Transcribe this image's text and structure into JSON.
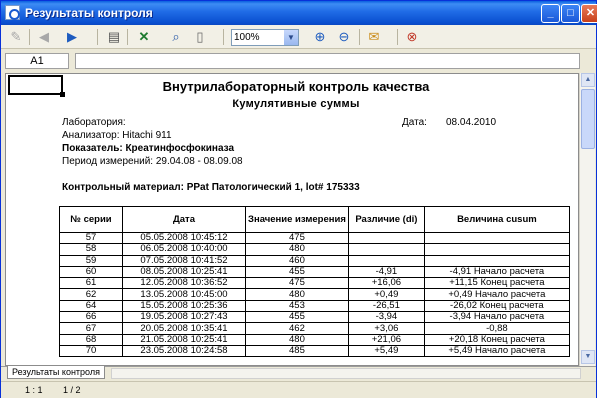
{
  "window": {
    "title": "Результаты контроля",
    "minimize": "_",
    "maximize": "□",
    "close": "✕"
  },
  "toolbar": {
    "zoom_value": "100%",
    "icons": [
      "paperclip-icon",
      "back-icon",
      "forward-icon",
      "print-icon",
      "excel-export-icon",
      "search-icon",
      "page-icon",
      "zoom-in-icon",
      "zoom-out-icon",
      "email-icon",
      "close-doc-icon"
    ]
  },
  "formula_bar": {
    "cell_ref": "A1",
    "value": ""
  },
  "report": {
    "title": "Внутрилабораторный контроль качества",
    "subtitle": "Кумулятивные суммы",
    "lab_label": "Лаборатория:",
    "date_label": "Дата:",
    "date_value": "08.04.2010",
    "analyzer": "Анализатор: Hitachi 911",
    "indicator_label": "Показатель: ",
    "indicator_value": "Креатинфосфокиназа",
    "period": "Период измерений: 29.04.08 - 08.09.08",
    "control_material": "Контрольный материал: PPat Патологический 1, lot# 175333"
  },
  "table": {
    "headers": [
      "№ серии",
      "Дата",
      "Значение измерения",
      "Различие (di)",
      "Величина cusum"
    ],
    "rows": [
      [
        "57",
        "05.05.2008 10:45:12",
        "475",
        "",
        ""
      ],
      [
        "58",
        "06.05.2008 10:40:00",
        "480",
        "",
        ""
      ],
      [
        "59",
        "07.05.2008 10:41:52",
        "460",
        "",
        ""
      ],
      [
        "60",
        "08.05.2008 10:25:41",
        "455",
        "-4,91",
        "-4,91 Начало расчета"
      ],
      [
        "61",
        "12.05.2008 10:36:52",
        "475",
        "+16,06",
        "+11,15 Конец расчета"
      ],
      [
        "62",
        "13.05.2008 10:45:00",
        "480",
        "+0,49",
        "+0,49 Начало расчета"
      ],
      [
        "64",
        "15.05.2008 10:25:36",
        "453",
        "-26,51",
        "-26,02 Конец расчета"
      ],
      [
        "66",
        "19.05.2008 10:27:43",
        "455",
        "-3,94",
        "-3,94 Начало расчета"
      ],
      [
        "67",
        "20.05.2008 10:35:41",
        "462",
        "+3,06",
        "-0,88"
      ],
      [
        "68",
        "21.05.2008 10:25:41",
        "480",
        "+21,06",
        "+20,18 Конец расчета"
      ],
      [
        "70",
        "23.05.2008 10:24:58",
        "485",
        "+5,49",
        "+5,49 Начало расчета"
      ]
    ]
  },
  "sheet_tab": "Результаты контроля",
  "status": {
    "scale": "1 : 1",
    "pages": "1 / 2"
  }
}
